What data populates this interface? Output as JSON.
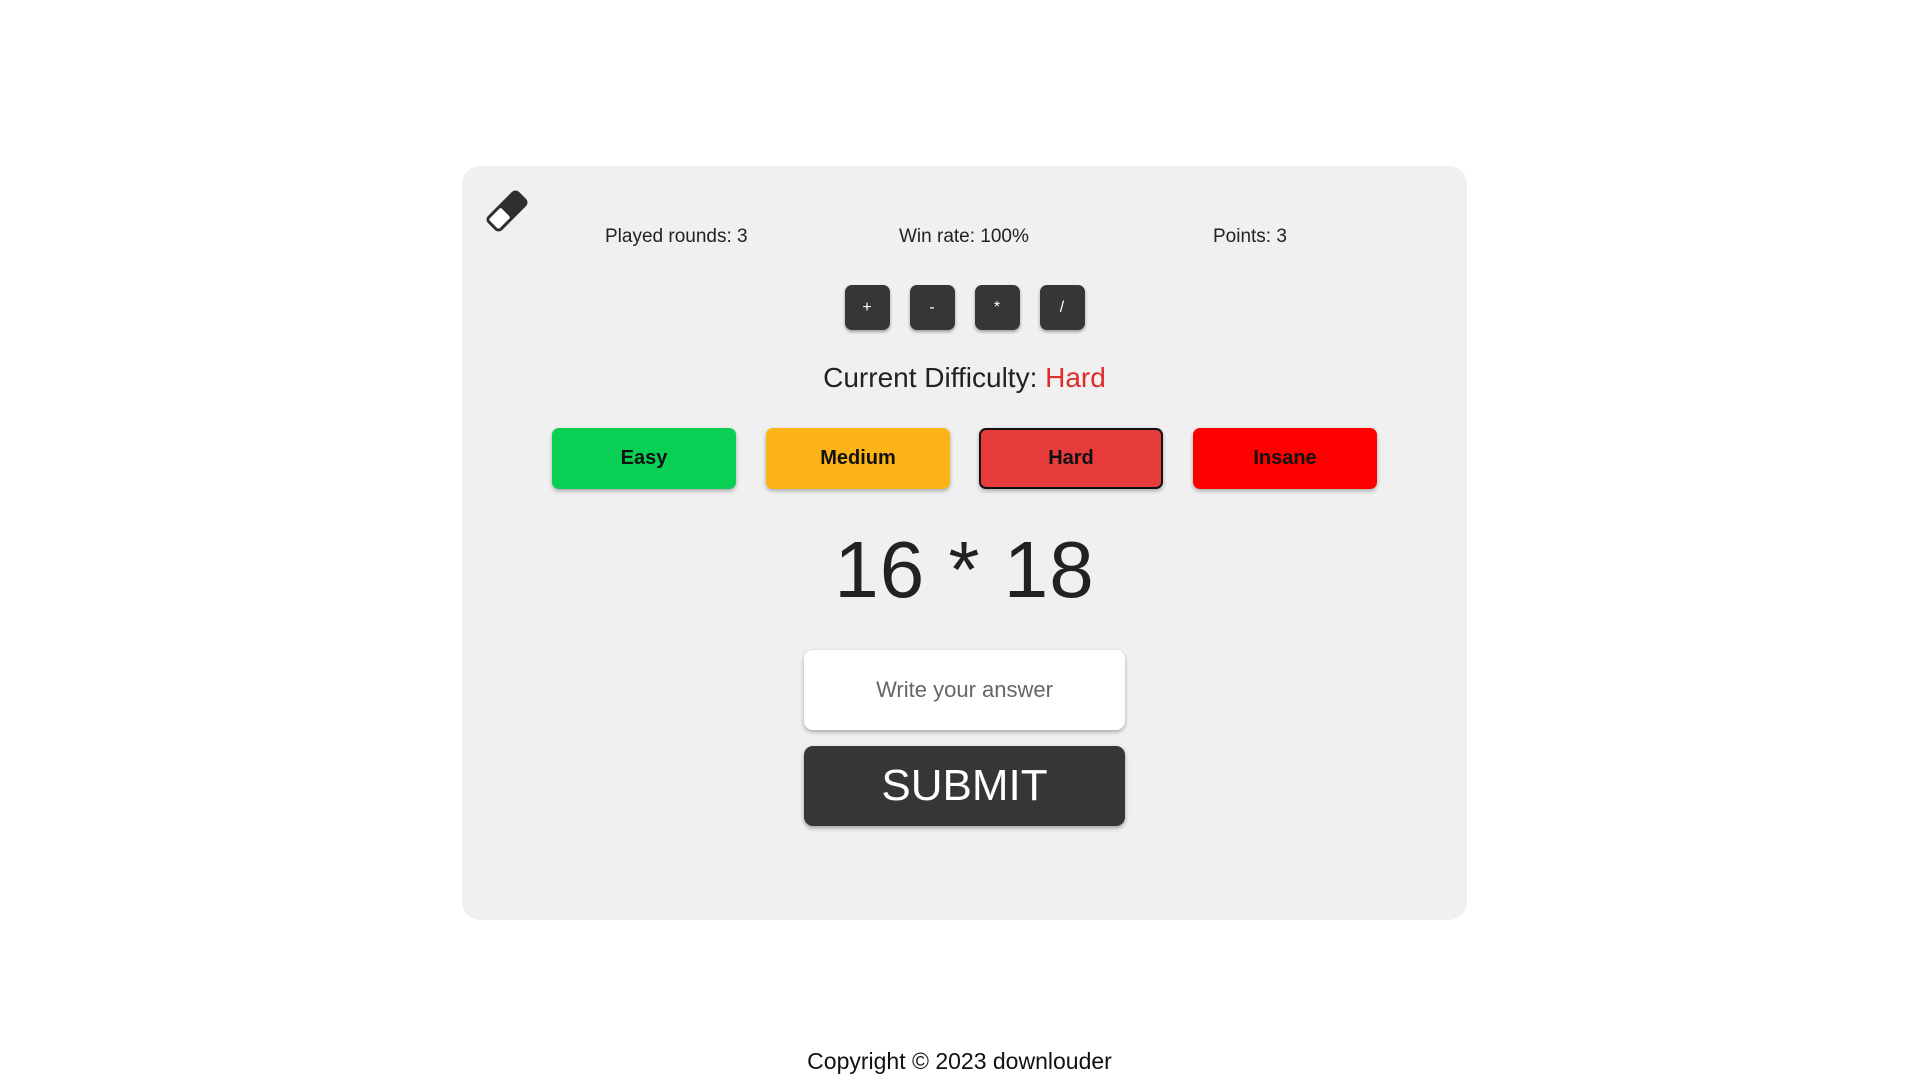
{
  "stats": {
    "played_rounds": "Played rounds: 3",
    "win_rate": "Win rate: 100%",
    "points": "Points: 3"
  },
  "operations": [
    "+",
    "-",
    "*",
    "/"
  ],
  "difficulty": {
    "label": "Current Difficulty: ",
    "value": "Hard",
    "value_color": "#e02b2b",
    "options": [
      {
        "label": "Easy",
        "color": "#09d055"
      },
      {
        "label": "Medium",
        "color": "#fbb317"
      },
      {
        "label": "Hard",
        "color": "#e83b3b",
        "selected": true
      },
      {
        "label": "Insane",
        "color": "#ff0000"
      }
    ]
  },
  "problem": "16 * 18",
  "answer": {
    "value": "",
    "placeholder": "Write your answer"
  },
  "submit_label": "SUBMIT",
  "footer": "Copyright © 2023 downlouder",
  "icons": {
    "reset": "eraser-icon"
  }
}
